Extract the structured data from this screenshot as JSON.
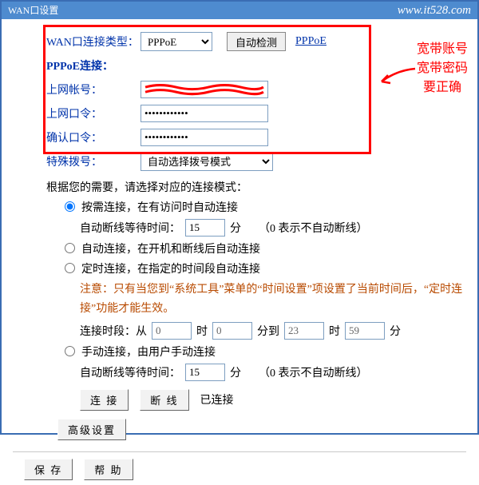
{
  "header": {
    "title": "WAN口设置",
    "url": "www.it528.com"
  },
  "annot": {
    "line1": "宽带账号",
    "line2": "宽带密码",
    "line3": "要正确"
  },
  "wan": {
    "type_label": "WAN口连接类型：",
    "type_options": [
      "PPPoE"
    ],
    "type_value": "PPPoE",
    "detect_btn": "自动检测",
    "pppoe_link": "PPPoE",
    "pppoe_conn_label": "PPPoE连接：",
    "account_label": "上网帐号：",
    "account_value": "",
    "password_label": "上网口令：",
    "password_value": "••••••••••••",
    "confirm_label": "确认口令：",
    "confirm_value": "••••••••••••",
    "special_dial_label": "特殊拨号：",
    "special_dial_options": [
      "自动选择拨号模式"
    ],
    "special_dial_value": "自动选择拨号模式"
  },
  "modes": {
    "intro": "根据您的需要，请选择对应的连接模式：",
    "on_demand": {
      "label": "按需连接，在有访问时自动连接",
      "wait_label": "自动断线等待时间：",
      "wait_value": "15",
      "unit": "分",
      "note": "（0 表示不自动断线）"
    },
    "auto": {
      "label": "自动连接，在开机和断线后自动连接"
    },
    "scheduled": {
      "label": "定时连接，在指定的时间段自动连接",
      "warn": "注意：只有当您到“系统工具”菜单的“时间设置”项设置了当前时间后，“定时连接”功能才能生效。",
      "period_label": "连接时段：从",
      "h1": "0",
      "m1": "0",
      "to": "分到",
      "h2": "23",
      "m2": "59",
      "h_unit": "时",
      "m_unit": "分"
    },
    "manual": {
      "label": "手动连接，由用户手动连接",
      "wait_label": "自动断线等待时间：",
      "wait_value": "15",
      "unit": "分",
      "note": "（0 表示不自动断线）"
    }
  },
  "conn": {
    "connect_btn": "连 接",
    "disconnect_btn": "断 线",
    "status": "已连接"
  },
  "adv_btn": "高级设置",
  "footer": {
    "save": "保 存",
    "help": "帮 助"
  }
}
